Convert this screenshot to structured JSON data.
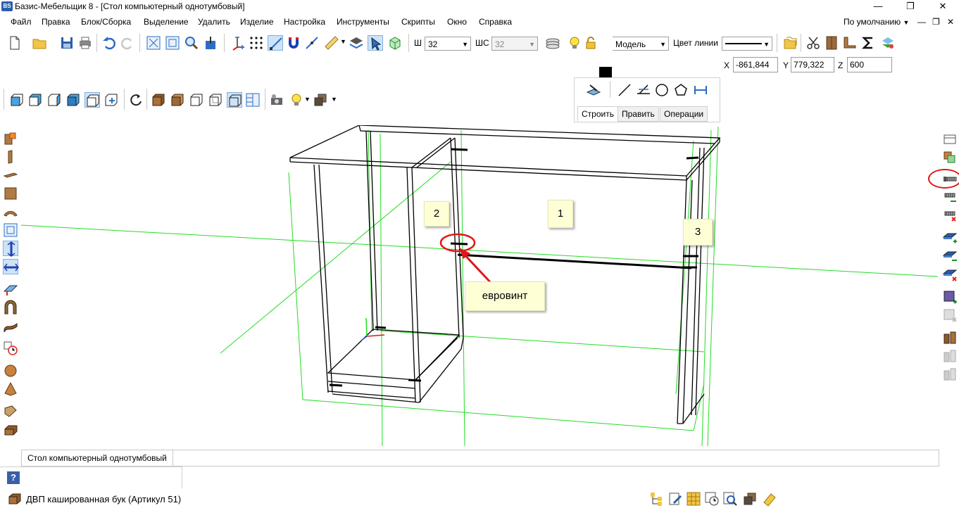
{
  "window": {
    "title": "Базис-Мебельщик 8 - [Стол компьютерный однотумбовый]",
    "app_icon_text": "BS",
    "controls": [
      "minimize-icon",
      "restore-icon",
      "close-icon"
    ]
  },
  "menu": {
    "items": [
      "Файл",
      "Правка",
      "Блок/Сборка",
      "Выделение",
      "Удалить",
      "Изделие",
      "Настройка",
      "Инструменты",
      "Скрипты",
      "Окно",
      "Справка"
    ],
    "view_mode": "По умолчанию"
  },
  "toolbar": {
    "w_label": "Ш",
    "w_value": "32",
    "ws_label": "ШС",
    "ws_value": "32",
    "layer_value": "Модель",
    "line_color_label": "Цвет линии"
  },
  "coords": {
    "x_label": "X",
    "x_value": "-861,844",
    "y_label": "Y",
    "y_value": "779,322",
    "z_label": "Z",
    "z_value": "600"
  },
  "build_panel": {
    "tabs": [
      "Строить",
      "Править",
      "Операции"
    ],
    "active_tab": "Строить"
  },
  "viewport": {
    "callouts": {
      "label_1": "1",
      "label_2": "2",
      "label_3": "3",
      "eurovint": "евровинт"
    },
    "highlight_color": "#e01818",
    "grid_color": "#22dd22",
    "wire_color": "#000000"
  },
  "status": {
    "model_name": "Стол компьютерный однотумбовый",
    "help_icon": "question-icon",
    "material": "ДВП кашированная бук (Артикул 51)"
  }
}
